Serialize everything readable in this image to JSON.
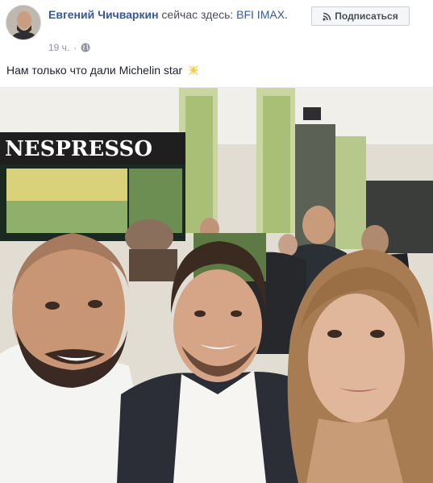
{
  "post": {
    "author": "Евгений Чичваркин",
    "checkin_text": " сейчас здесь: ",
    "place": "BFI IMAX.",
    "time": "19 ч.",
    "separator": "·",
    "privacy_icon": "globe-icon",
    "message": "Нам только что дали Michelin star",
    "emoji_icon": "sparkle-icon"
  },
  "subscribe_button": {
    "label": "Подписаться",
    "icon": "rss-icon"
  },
  "photo": {
    "brand_sign": "NESPRESSO"
  },
  "colors": {
    "link": "#385898",
    "meta": "#90949c",
    "button_bg": "#f5f6f7",
    "button_border": "#ccd0d5"
  }
}
